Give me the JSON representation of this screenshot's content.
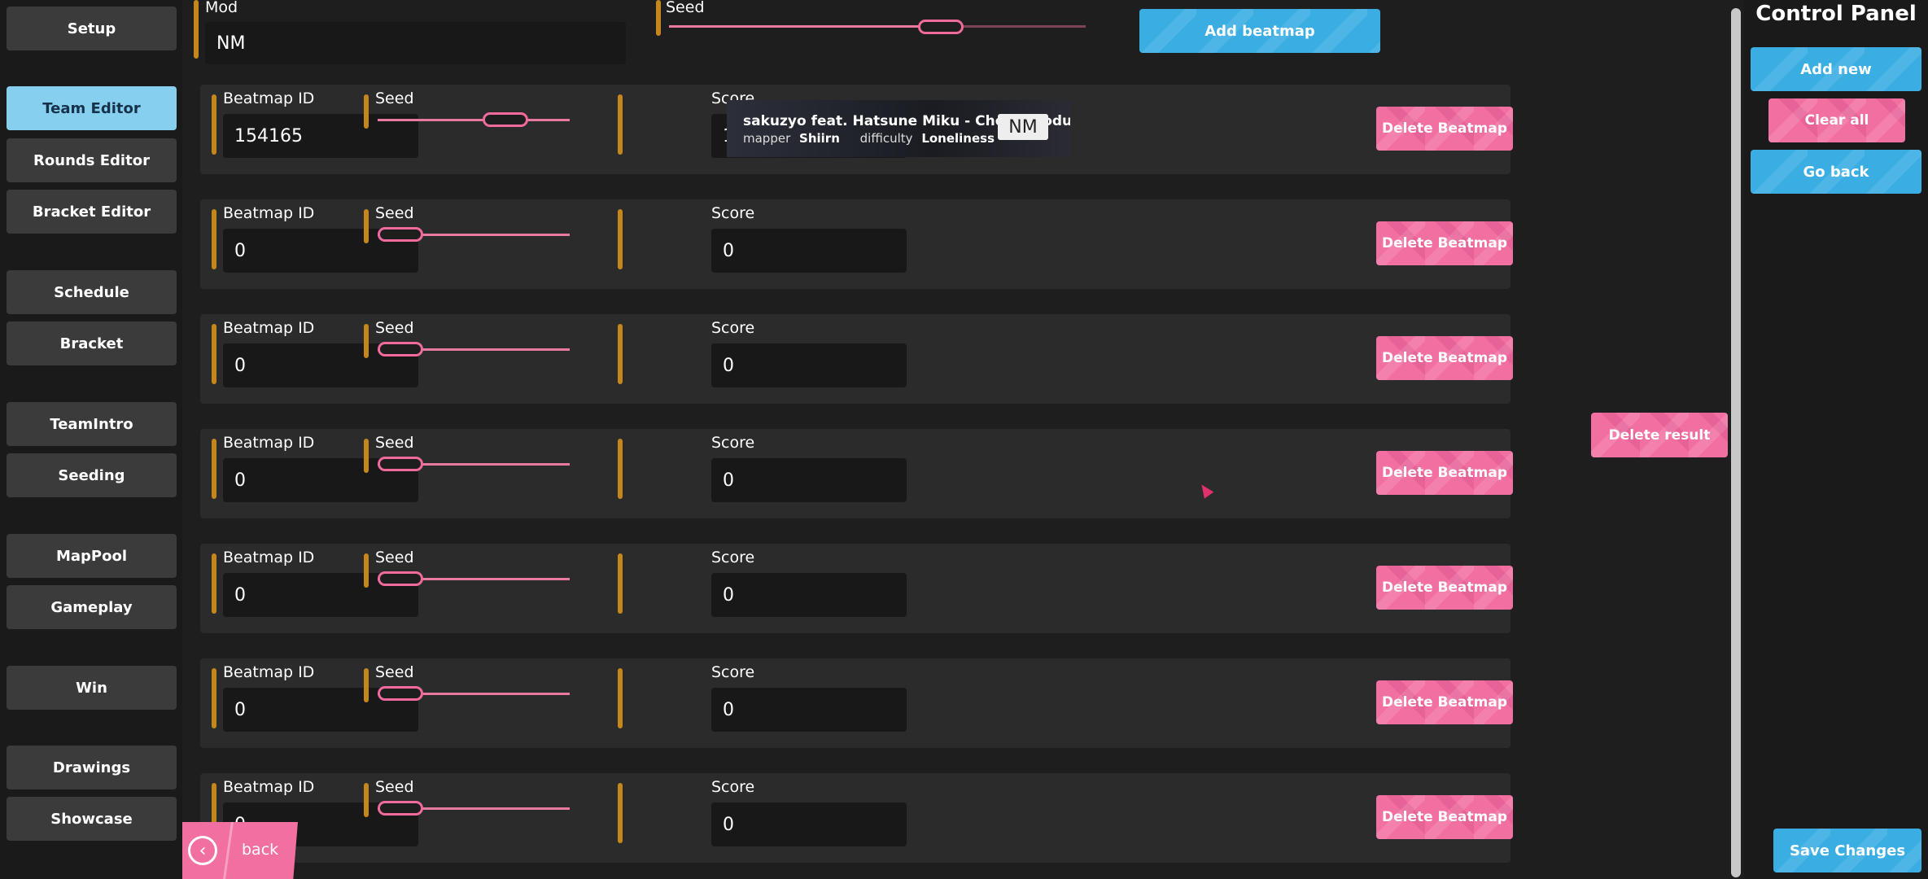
{
  "sidebar": {
    "items": [
      {
        "label": "Setup"
      },
      {
        "label": "Team Editor"
      },
      {
        "label": "Rounds Editor"
      },
      {
        "label": "Bracket Editor"
      },
      {
        "label": "Schedule"
      },
      {
        "label": "Bracket"
      },
      {
        "label": "TeamIntro"
      },
      {
        "label": "Seeding"
      },
      {
        "label": "MapPool"
      },
      {
        "label": "Gameplay"
      },
      {
        "label": "Win"
      },
      {
        "label": "Drawings"
      },
      {
        "label": "Showcase"
      }
    ],
    "active": "Team Editor"
  },
  "header": {
    "mod_label": "Mod",
    "mod_value": "NM",
    "seed_label": "Seed",
    "add_beatmap_label": "Add beatmap"
  },
  "beatmap_rows": [
    {
      "id_label": "Beatmap ID",
      "id_value": "154165",
      "seed_label": "Seed",
      "score_label": "Score",
      "score_value": "1300000",
      "delete_label": "Delete Beatmap"
    },
    {
      "id_label": "Beatmap ID",
      "id_value": "0",
      "seed_label": "Seed",
      "score_label": "Score",
      "score_value": "0",
      "delete_label": "Delete Beatmap"
    },
    {
      "id_label": "Beatmap ID",
      "id_value": "0",
      "seed_label": "Seed",
      "score_label": "Score",
      "score_value": "0",
      "delete_label": "Delete Beatmap"
    },
    {
      "id_label": "Beatmap ID",
      "id_value": "0",
      "seed_label": "Seed",
      "score_label": "Score",
      "score_value": "0",
      "delete_label": "Delete Beatmap"
    },
    {
      "id_label": "Beatmap ID",
      "id_value": "0",
      "seed_label": "Seed",
      "score_label": "Score",
      "score_value": "0",
      "delete_label": "Delete Beatmap"
    },
    {
      "id_label": "Beatmap ID",
      "id_value": "0",
      "seed_label": "Seed",
      "score_label": "Score",
      "score_value": "0",
      "delete_label": "Delete Beatmap"
    },
    {
      "id_label": "Beatmap ID",
      "id_value": "0",
      "seed_label": "Seed",
      "score_label": "Score",
      "score_value": "0",
      "delete_label": "Delete Beatmap"
    }
  ],
  "beatmap_card": {
    "title": "sakuzyo feat. Hatsune Miku - ChoiN Production",
    "mapper_label": "mapper",
    "mapper": "Shiirn",
    "difficulty_label": "difficulty",
    "difficulty": "Loneliness",
    "mod": "NM"
  },
  "delete_result_label": "Delete result",
  "back": {
    "label": "back"
  },
  "panel": {
    "title": "Control Panel",
    "add_new": "Add new",
    "clear_all": "Clear all",
    "go_back": "Go back",
    "save_changes": "Save Changes"
  },
  "colors": {
    "accent_orange": "#c5871b",
    "pink": "#f26fa2",
    "blue": "#3aaee3",
    "active_tab": "#86cfee"
  }
}
